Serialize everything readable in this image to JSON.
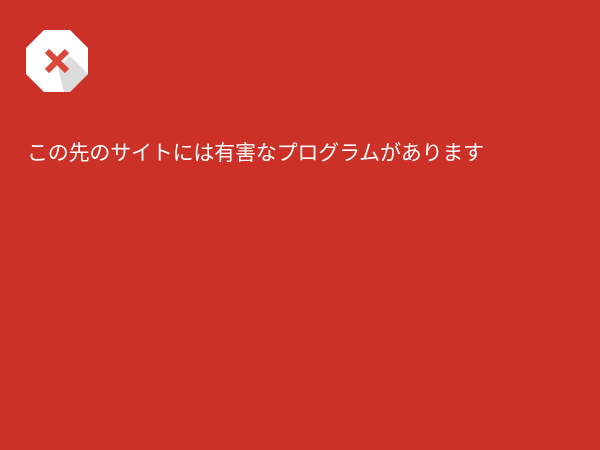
{
  "page": {
    "background_color": "#cb3127",
    "icon": {
      "name": "warning-stop-icon",
      "badge_color": "#ffffff",
      "mark_color": "#d9463a",
      "shadow_color": "#dcdcdc"
    },
    "heading": "この先のサイトには有害なプログラムがあります",
    "text_color": "#ffffff"
  }
}
